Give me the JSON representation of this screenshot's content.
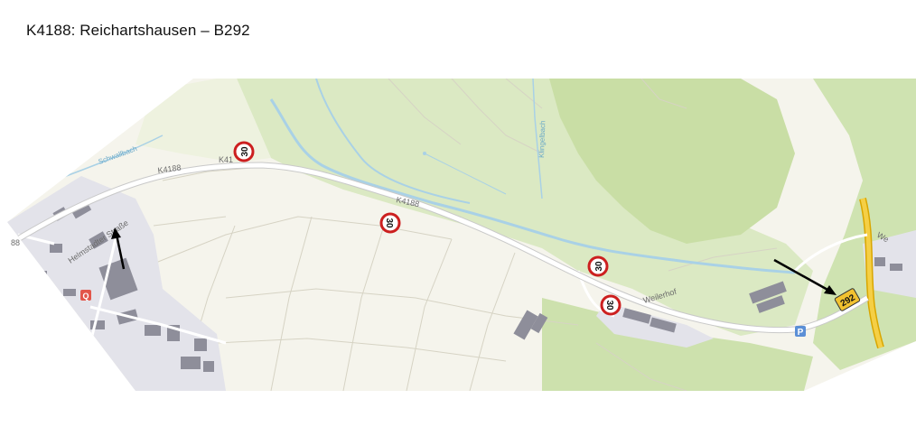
{
  "title": "K4188: Reichartshausen – B292",
  "map": {
    "labels": {
      "road_west": "K4188",
      "road_west_short": "K41",
      "road_mid": "K4188",
      "street_helmstadter": "Helmstadter Straße",
      "street_left_edge": "88",
      "hamlet": "Weilerhof",
      "stream_left": "Schwallbach",
      "stream_right": "Klingelbach",
      "edge_right": "We"
    },
    "speed_limit_signs": [
      {
        "value": "30"
      },
      {
        "value": "30"
      },
      {
        "value": "30"
      },
      {
        "value": "30"
      }
    ],
    "route_shield": {
      "value": "292"
    },
    "parking_symbol": "P",
    "poi_symbol": "Q",
    "colors": {
      "forest": "#cfe2b0",
      "meadow": "#f4f3ea",
      "river": "#a9d1e6",
      "road": "#ffffff",
      "route_yellow": "#f2c230",
      "sign_red": "#cc1f1f",
      "built": "#c8c8d2",
      "building": "#8d8d98"
    }
  }
}
